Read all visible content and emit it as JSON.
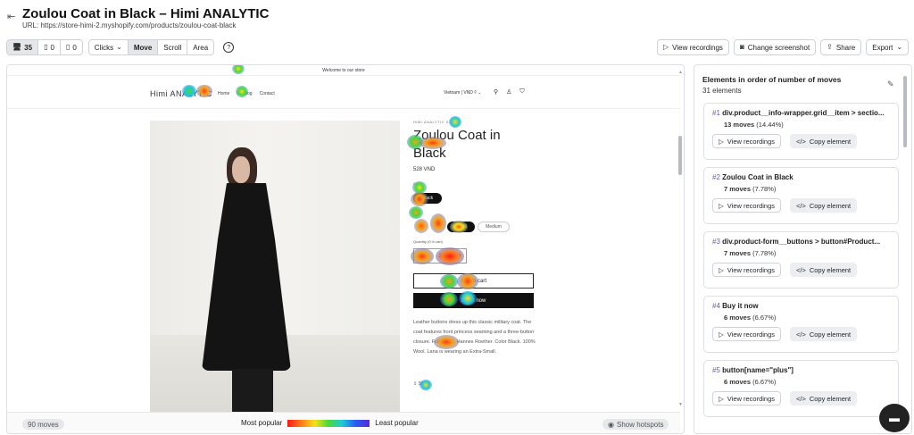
{
  "header": {
    "title": "Zoulou Coat in Black – Himi ANALYTIC",
    "url": "URL: https://store-himi-2.myshopify.com/products/zoulou-coat-black"
  },
  "toolbar": {
    "devices": [
      {
        "icon": "desktop-icon",
        "count": "35"
      },
      {
        "icon": "tablet-icon",
        "count": "0"
      },
      {
        "icon": "mobile-icon",
        "count": "0"
      }
    ],
    "modes": [
      "Clicks",
      "Move",
      "Scroll",
      "Area"
    ],
    "active_mode": "Move",
    "help": "?",
    "view_recordings": "View recordings",
    "change_screenshot": "Change screenshot",
    "share": "Share",
    "export": "Export"
  },
  "store": {
    "announcement": "Welcome to our store",
    "logo": "Himi ANALYTIC",
    "nav": [
      "Home",
      "Catalog",
      "Contact"
    ],
    "currency": "Vietnam | VND ₫",
    "vendor": "HIMI ANALYTIC STORE",
    "product_title": "Zoulou Coat in Black",
    "price": "528 VND",
    "color_label": "Color",
    "color_value": "Black",
    "size_label": "Size",
    "sizes": [
      "Small",
      "Medium"
    ],
    "quantity_label": "Quantity (0 in cart)",
    "quantity": "1",
    "add_to_cart": "Add to cart",
    "buy_now": "Buy it now",
    "description": "Leather buttons dress up this classic military coat. The coat features front princess seaming and a three-button closure. Fully lined. Hannes Roether. Color Black. 100% Wool. Lana is wearing an Extra-Small.",
    "share": "Share"
  },
  "footer": {
    "moves": "90 moves",
    "most_popular": "Most popular",
    "least_popular": "Least popular",
    "show_hotspots": "Show hotspots"
  },
  "panel": {
    "title": "Elements in order of number of moves",
    "subtitle": "31 elements",
    "view_recordings": "View recordings",
    "copy_element": "Copy element",
    "items": [
      {
        "num": "#1",
        "name": "div.product__info-wrapper.grid__item > sectio...",
        "moves": "13 moves",
        "pct": "(14.44%)"
      },
      {
        "num": "#2",
        "name": "Zoulou Coat in Black",
        "moves": "7 moves",
        "pct": "(7.78%)"
      },
      {
        "num": "#3",
        "name": "div.product-form__buttons > button#Product...",
        "moves": "7 moves",
        "pct": "(7.78%)"
      },
      {
        "num": "#4",
        "name": "Buy it now",
        "moves": "6 moves",
        "pct": "(6.67%)"
      },
      {
        "num": "#5",
        "name": "button[name=\"plus\"]",
        "moves": "6 moves",
        "pct": "(6.67%)"
      }
    ]
  }
}
